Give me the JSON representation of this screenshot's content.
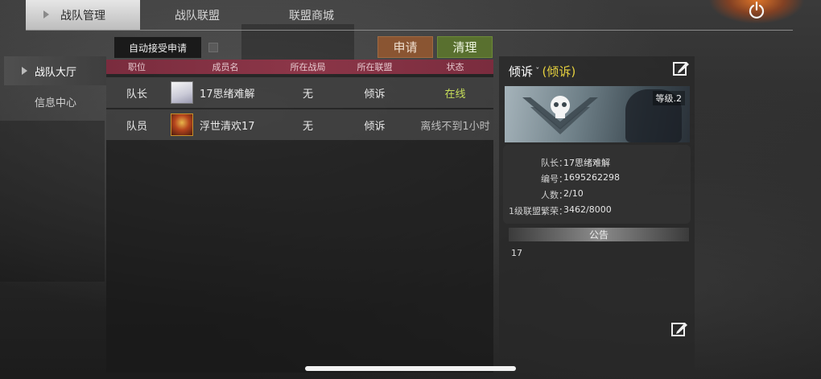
{
  "top_tabs": [
    {
      "label": "战队管理",
      "active": true
    },
    {
      "label": "战队联盟",
      "active": false
    },
    {
      "label": "联盟商城",
      "active": false
    }
  ],
  "power_icon": "power-icon",
  "sidebar": {
    "items": [
      {
        "label": "战队大厅",
        "active": true
      },
      {
        "label": "信息中心",
        "active": false
      }
    ]
  },
  "toolbar": {
    "auto_accept_label": "自动接受申请",
    "auto_accept_checked": false,
    "apply_label": "申请",
    "clear_label": "清理"
  },
  "members_table": {
    "headers": [
      "职位",
      "成员名",
      "所在战局",
      "所在联盟",
      "状态"
    ],
    "rows": [
      {
        "position": "队长",
        "name": "17思绪难解",
        "match": "无",
        "alliance": "倾诉",
        "status": "在线",
        "avatar": "white-hair-avatar"
      },
      {
        "position": "队员",
        "name": "浮世清欢17",
        "match": "无",
        "alliance": "倾诉",
        "status": "离线不到1小时",
        "avatar": "red-dress-avatar"
      }
    ]
  },
  "team_info": {
    "name": "倾诉",
    "alliance_tag": "(倾诉)",
    "level": "等级.2",
    "stats": [
      {
        "label": "队长：",
        "value": "17思绪难解"
      },
      {
        "label": "编号：",
        "value": "1695262298"
      },
      {
        "label": "人数：",
        "value": "2/10"
      },
      {
        "label": "1级联盟繁荣：",
        "value": "3462/8000"
      }
    ],
    "notice_title": "公告",
    "notice_text": "17",
    "edit_icon": "edit-icon"
  },
  "colors": {
    "header_red": "#8c3648",
    "online_green": "#c6dd5a",
    "alliance_yellow": "#e6d13e",
    "apply_brown": "#8a5532",
    "clear_green": "#59702f"
  }
}
